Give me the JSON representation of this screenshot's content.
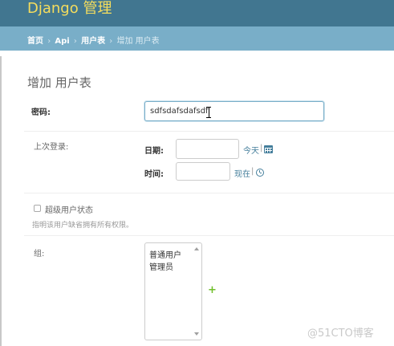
{
  "header": {
    "brand": "Django 管理"
  },
  "breadcrumbs": {
    "home": "首页",
    "app": "Api",
    "model": "用户表",
    "current": "增加 用户表",
    "separator": "›"
  },
  "page": {
    "title": "增加 用户表"
  },
  "fields": {
    "password": {
      "label": "密码:",
      "value": "sdfsdafsdafsdf"
    },
    "last_login": {
      "label": "上次登录:",
      "date_label": "日期:",
      "date_value": "",
      "today_link": "今天",
      "time_label": "时间:",
      "time_value": "",
      "now_link": "现在",
      "link_separator": "|"
    },
    "is_superuser": {
      "label": "超级用户状态",
      "help": "指明该用户缺省拥有所有权限。",
      "checked": false
    },
    "groups": {
      "label": "组:",
      "options": [
        "普通用户",
        "管理员"
      ],
      "add_symbol": "+"
    }
  },
  "watermark": "@51CTO博客",
  "colors": {
    "header_bg": "#417690",
    "brand_text": "#f5dd5d",
    "breadcrumb_bg": "#79aec8",
    "link": "#447e9b",
    "add_green": "#70bf2b"
  }
}
